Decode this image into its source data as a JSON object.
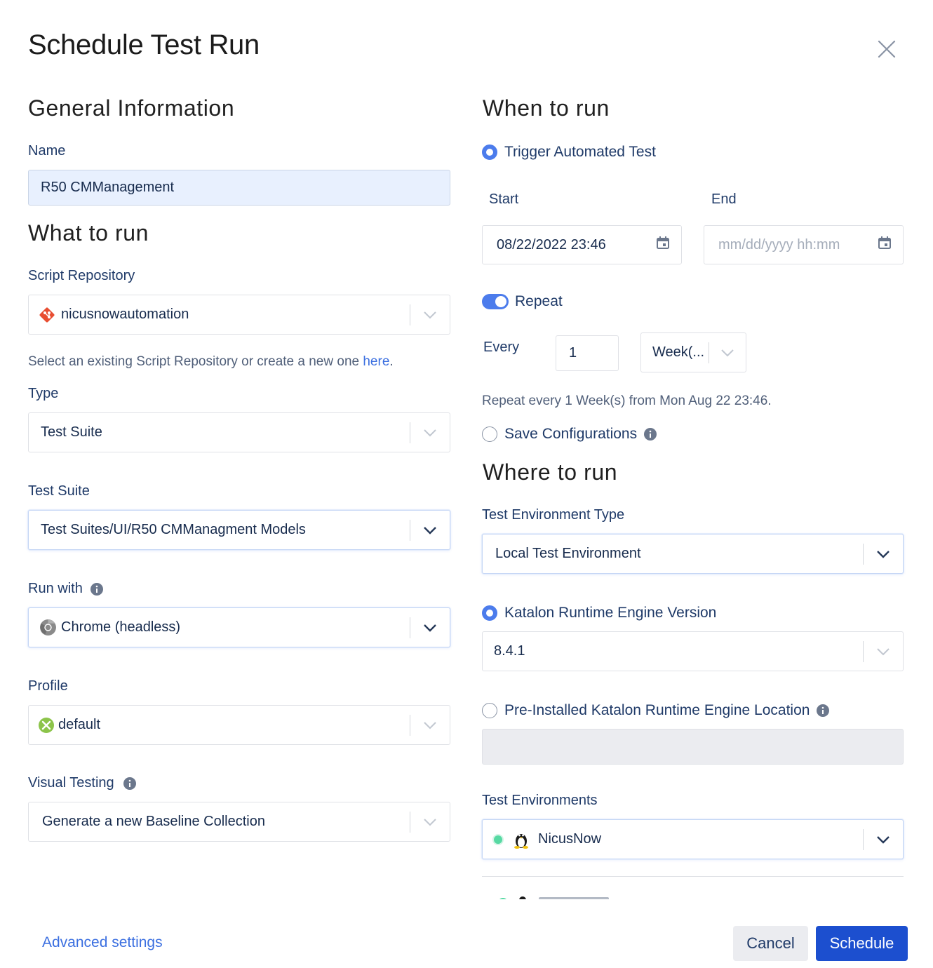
{
  "dialog": {
    "title": "Schedule Test Run"
  },
  "general": {
    "heading": "General Information",
    "name_label": "Name",
    "name_value": "R50 CMManagement"
  },
  "what": {
    "heading": "What to run",
    "repo_label": "Script Repository",
    "repo_value": "nicusnowautomation",
    "repo_help_prefix": "Select an existing Script Repository or create a new one",
    "repo_help_link": "here",
    "repo_help_suffix": ".",
    "type_label": "Type",
    "type_value": "Test Suite",
    "suite_label": "Test Suite",
    "suite_value": "Test Suites/UI/R50 CMManagment Models",
    "runwith_label": "Run with",
    "runwith_value": "Chrome (headless)",
    "profile_label": "Profile",
    "profile_value": "default",
    "visual_label": "Visual Testing",
    "visual_value": "Generate a new Baseline Collection"
  },
  "when": {
    "heading": "When to run",
    "trigger_label": "Trigger Automated Test",
    "start_label": "Start",
    "start_value": "08/22/2022 23:46",
    "end_label": "End",
    "end_placeholder": "mm/dd/yyyy hh:mm",
    "repeat_label": "Repeat",
    "repeat_on": true,
    "every_label": "Every",
    "every_value": "1",
    "unit_value": "Week(...",
    "repeat_summary": "Repeat every 1 Week(s) from Mon Aug 22 23:46.",
    "save_config_label": "Save Configurations"
  },
  "where": {
    "heading": "Where to run",
    "env_type_label": "Test Environment Type",
    "env_type_value": "Local Test Environment",
    "kre_version_label": "Katalon Runtime Engine Version",
    "kre_version_value": "8.4.1",
    "kre_location_label": "Pre-Installed Katalon Runtime Engine Location",
    "envs_label": "Test Environments",
    "envs_value": "NicusNow"
  },
  "footer": {
    "advanced_label": "Advanced settings",
    "cancel_label": "Cancel",
    "schedule_label": "Schedule"
  },
  "colors": {
    "accent": "#4c7cec",
    "primary_button": "#1c4fcf",
    "label_text": "#1f3a68",
    "status_online": "#57d9a3"
  }
}
